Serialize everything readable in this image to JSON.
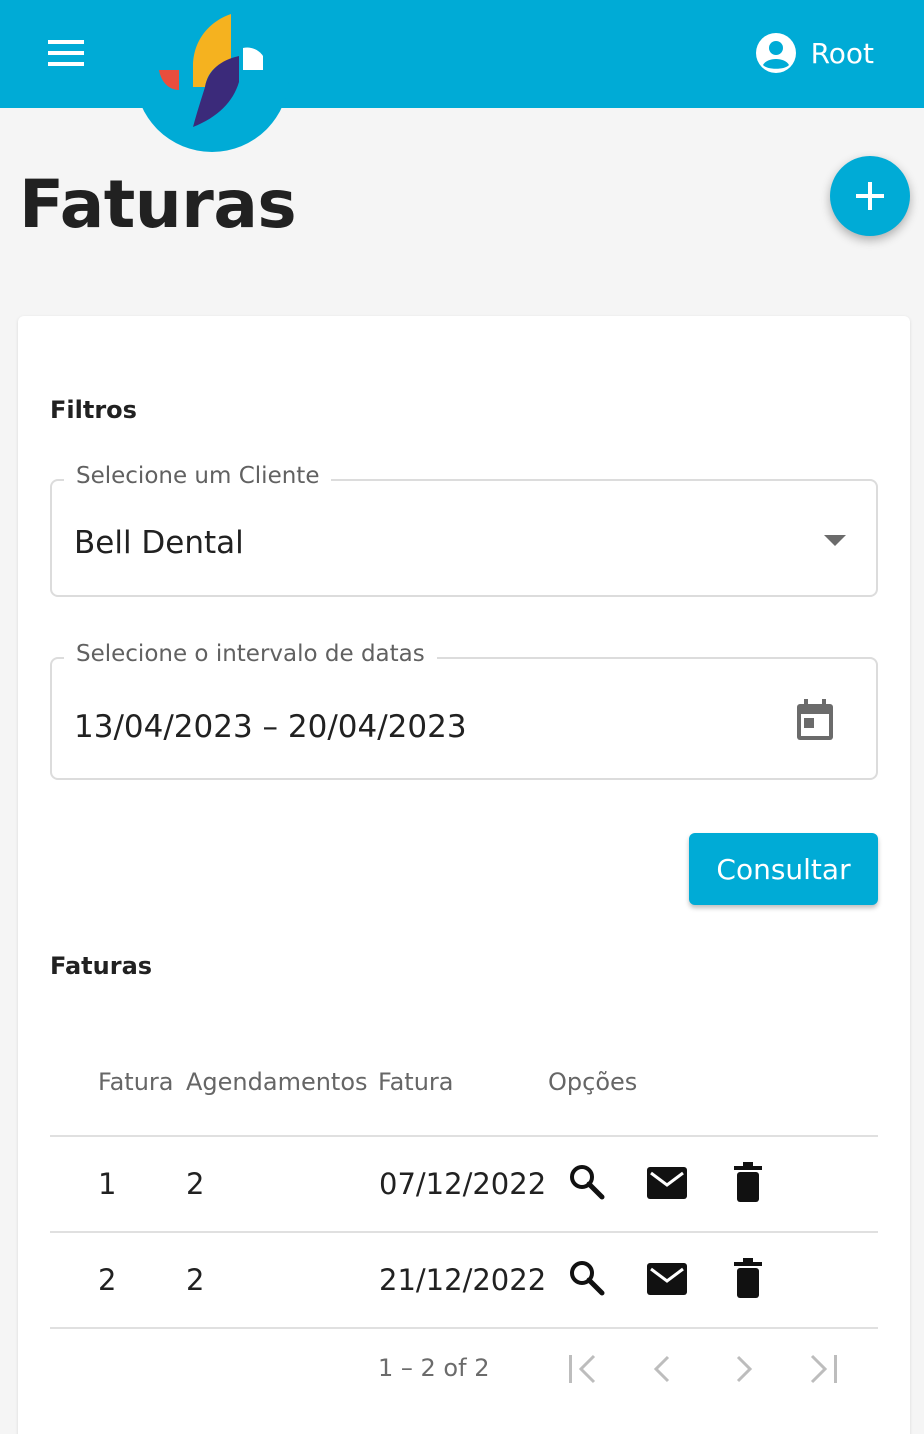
{
  "header": {
    "user_name": "Root"
  },
  "page": {
    "title": "Faturas"
  },
  "filters": {
    "section_title": "Filtros",
    "client": {
      "label": "Selecione um Cliente",
      "value": "Bell Dental"
    },
    "date_range": {
      "label": "Selecione o intervalo de datas",
      "value": "13/04/2023 – 20/04/2023"
    },
    "submit_label": "Consultar"
  },
  "invoices": {
    "section_title": "Faturas",
    "columns": [
      "Fatura",
      "Agendamentos",
      "Fatura",
      "Opções"
    ],
    "rows": [
      {
        "fatura": "1",
        "agendamentos": "2",
        "data": "07/12/2022"
      },
      {
        "fatura": "2",
        "agendamentos": "2",
        "data": "21/12/2022"
      }
    ],
    "paginator": {
      "range_label": "1 – 2 of 2"
    }
  },
  "colors": {
    "primary": "#00abd6",
    "logo_yellow": "#f5b21f",
    "logo_red": "#e94e3d",
    "logo_purple": "#3b2a7a"
  },
  "icons": [
    "menu-icon",
    "user-circle-icon",
    "add-icon",
    "calendar-icon",
    "search-icon",
    "email-icon",
    "delete-icon",
    "first-page-icon",
    "chevron-left-icon",
    "chevron-right-icon",
    "last-page-icon"
  ]
}
